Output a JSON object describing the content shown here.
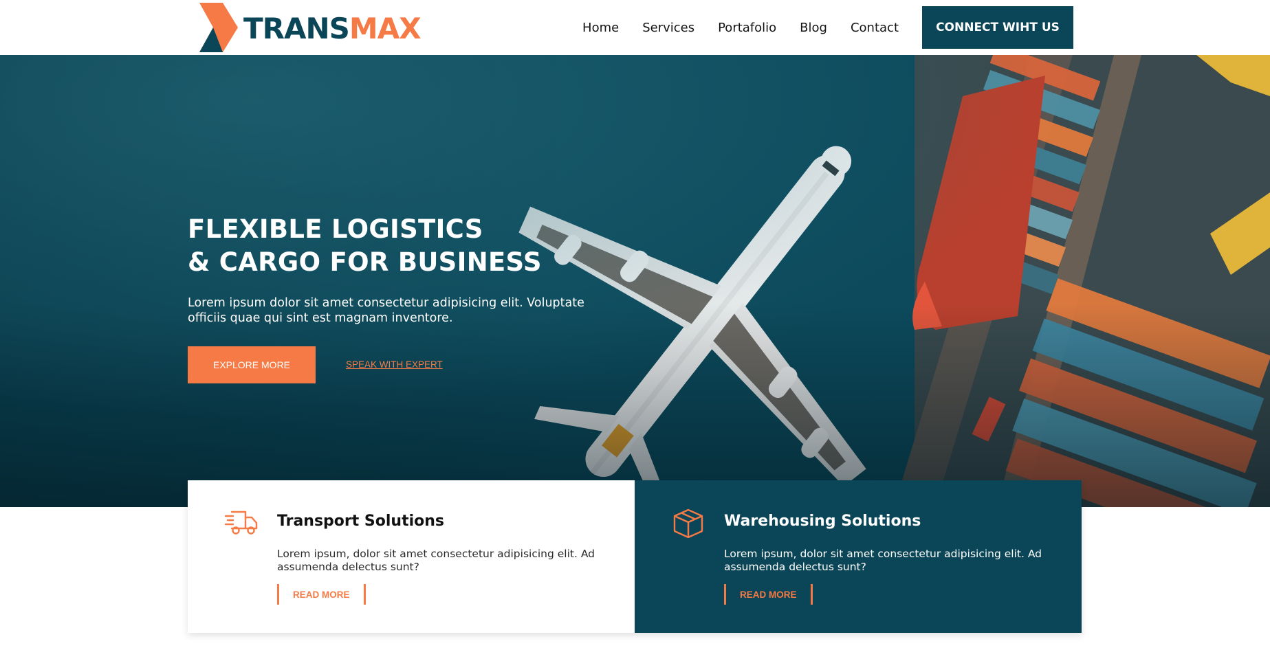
{
  "brand": {
    "name_part1": "TRANS",
    "name_part2": "MAX",
    "colors": {
      "primary": "#0b4658",
      "accent": "#f57a45"
    },
    "logo_icon": "transmax-logo-mark"
  },
  "nav": {
    "items": [
      "Home",
      "Services",
      "Portafolio",
      "Blog",
      "Contact"
    ],
    "cta_label": "CONNECT WIHT US"
  },
  "hero": {
    "title_line1": "FLEXIBLE LOGISTICS",
    "title_line2": "& CARGO FOR BUSINESS",
    "description": "Lorem ipsum dolor sit amet consectetur adipisicing elit. Voluptate officiis quae qui sint est magnam inventore.",
    "primary_button": "EXPLORE MORE",
    "secondary_link": "SPEAK WITH EXPERT",
    "image": "aerial-airplane-cargo-port"
  },
  "services": [
    {
      "icon": "delivery-truck-icon",
      "title": "Transport Solutions",
      "description": "Lorem ipsum, dolor sit amet consectetur adipisicing elit. Ad assumenda delectus sunt?",
      "link": "READ MORE"
    },
    {
      "icon": "package-box-icon",
      "title": "Warehousing Solutions",
      "description": "Lorem ipsum, dolor sit amet consectetur adipisicing elit. Ad assumenda delectus sunt?",
      "link": "READ MORE"
    }
  ]
}
